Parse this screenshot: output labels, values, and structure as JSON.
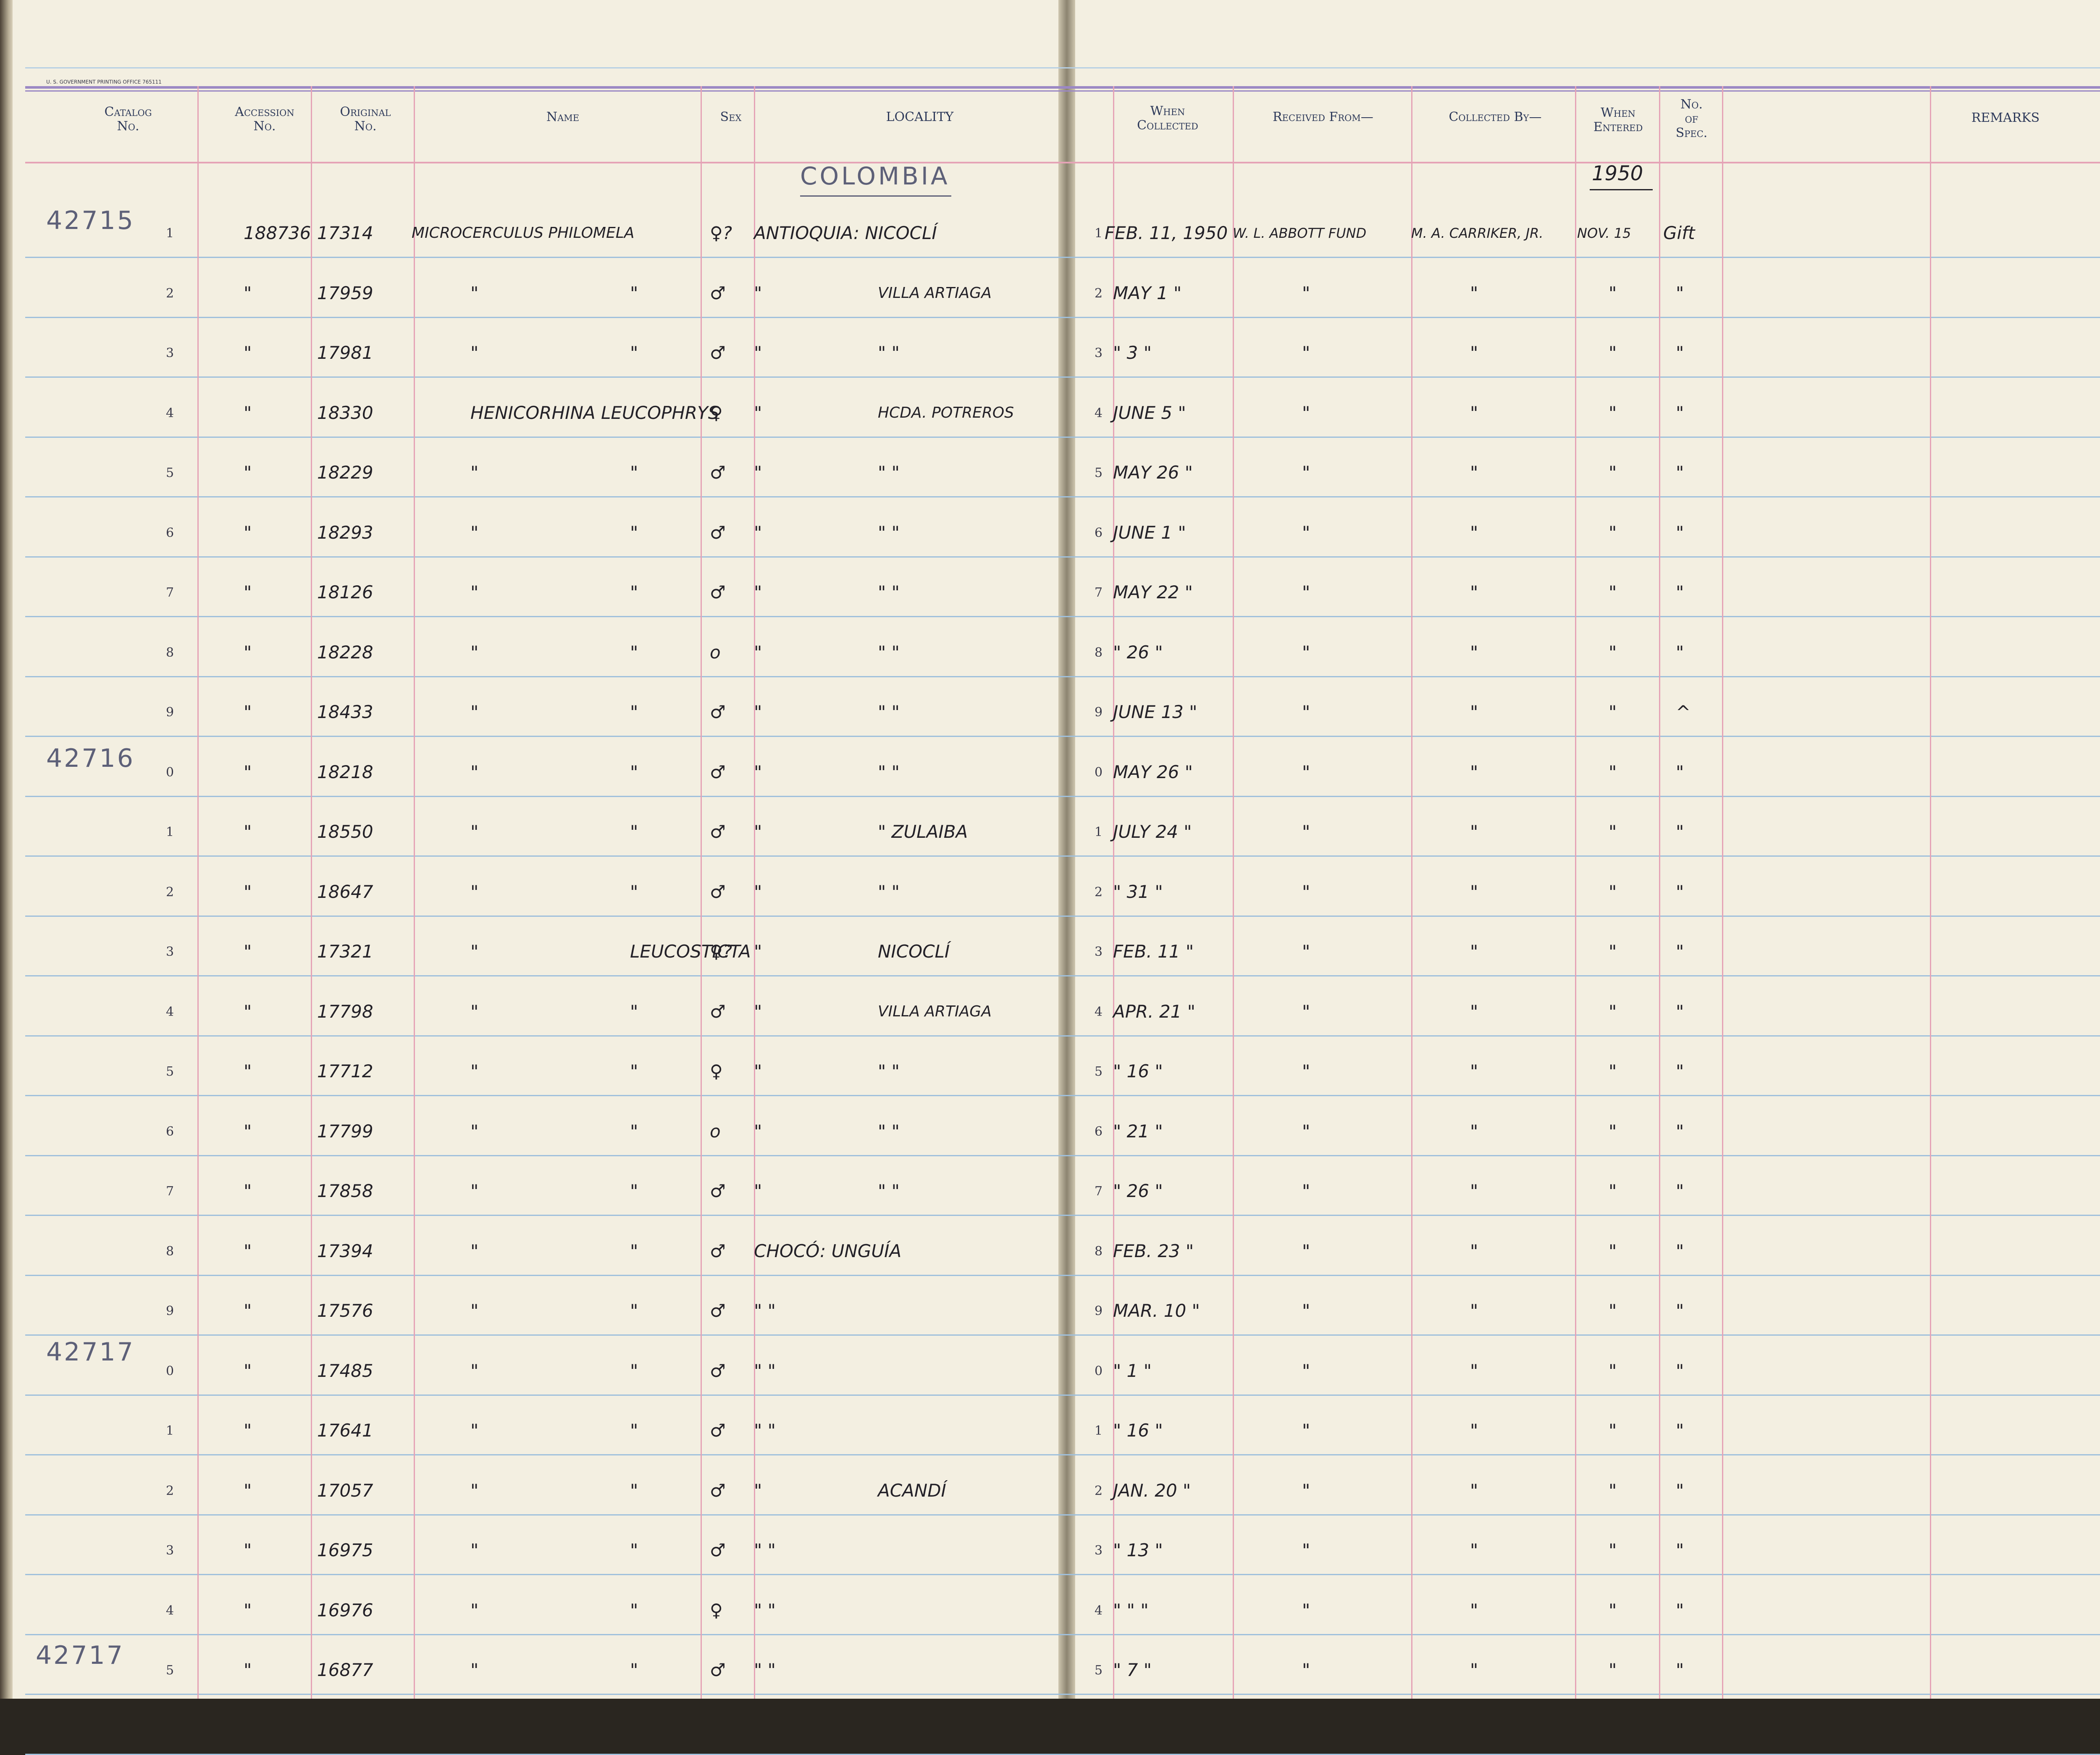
{
  "printer_line": "U. S. GOVERNMENT PRINTING OFFICE   765111",
  "headers": {
    "catalog": "Catalog\nNo.",
    "accession": "Accession\nNo.",
    "original": "Original\nNo.",
    "name": "Name",
    "sex": "Sex",
    "locality": "LOCALITY",
    "when_collected": "When\nCollected",
    "received_from": "Received From—",
    "collected_by": "Collected By—",
    "when_entered": "When\nEntered",
    "no_of_spec": "No.\nof\nSpec.",
    "remarks": "REMARKS"
  },
  "pencil": {
    "country_heading": "COLOMBIA",
    "year_entered": "1950"
  },
  "catalog_prefixes": [
    "42715",
    "42716",
    "42717",
    "42717"
  ],
  "rows": [
    {
      "digit": "1",
      "accession": "188736",
      "original": "17314",
      "name1": "MICROCERCULUS PHILOMELA",
      "name2": "",
      "sex": "♀?",
      "loc1": "ANTIOQUIA: NICOCLÍ",
      "loc2": "",
      "digit_r": "1",
      "collected": "FEB. 11, 1950",
      "received": "W. L. ABBOTT FUND",
      "collector": "M. A. CARRIKER, JR.",
      "entered": "NOV. 15",
      "spec": "Gift"
    },
    {
      "digit": "2",
      "accession": "\"",
      "original": "17959",
      "name1": "\"",
      "name2": "\"",
      "sex": "♂",
      "loc1": "\"",
      "loc2": "VILLA ARTIAGA",
      "digit_r": "2",
      "collected": "MAY 1 \"",
      "received": "\"",
      "collector": "\"",
      "entered": "\"",
      "spec": "\""
    },
    {
      "digit": "3",
      "accession": "\"",
      "original": "17981",
      "name1": "\"",
      "name2": "\"",
      "sex": "♂",
      "loc1": "\"",
      "loc2": "\"   \"",
      "digit_r": "3",
      "collected": "\" 3 \"",
      "received": "\"",
      "collector": "\"",
      "entered": "\"",
      "spec": "\""
    },
    {
      "digit": "4",
      "accession": "\"",
      "original": "18330",
      "name1": "HENICORHINA LEUCOPHRYS",
      "name2": "",
      "sex": "♀",
      "loc1": "\"",
      "loc2": "HCDA. POTREROS",
      "digit_r": "4",
      "collected": "JUNE 5 \"",
      "received": "\"",
      "collector": "\"",
      "entered": "\"",
      "spec": "\""
    },
    {
      "digit": "5",
      "accession": "\"",
      "original": "18229",
      "name1": "\"",
      "name2": "\"",
      "sex": "♂",
      "loc1": "\"",
      "loc2": "\"   \"",
      "digit_r": "5",
      "collected": "MAY 26 \"",
      "received": "\"",
      "collector": "\"",
      "entered": "\"",
      "spec": "\""
    },
    {
      "digit": "6",
      "accession": "\"",
      "original": "18293",
      "name1": "\"",
      "name2": "\"",
      "sex": "♂",
      "loc1": "\"",
      "loc2": "\"   \"",
      "digit_r": "6",
      "collected": "JUNE 1 \"",
      "received": "\"",
      "collector": "\"",
      "entered": "\"",
      "spec": "\""
    },
    {
      "digit": "7",
      "accession": "\"",
      "original": "18126",
      "name1": "\"",
      "name2": "\"",
      "sex": "♂",
      "loc1": "\"",
      "loc2": "\"   \"",
      "digit_r": "7",
      "collected": "MAY 22 \"",
      "received": "\"",
      "collector": "\"",
      "entered": "\"",
      "spec": "\""
    },
    {
      "digit": "8",
      "accession": "\"",
      "original": "18228",
      "name1": "\"",
      "name2": "\"",
      "sex": "o",
      "loc1": "\"",
      "loc2": "\"   \"",
      "digit_r": "8",
      "collected": "\" 26 \"",
      "received": "\"",
      "collector": "\"",
      "entered": "\"",
      "spec": "\""
    },
    {
      "digit": "9",
      "accession": "\"",
      "original": "18433",
      "name1": "\"",
      "name2": "\"",
      "sex": "♂",
      "loc1": "\"",
      "loc2": "\"   \"",
      "digit_r": "9",
      "collected": "JUNE 13 \"",
      "received": "\"",
      "collector": "\"",
      "entered": "\"",
      "spec": "^"
    },
    {
      "digit": "0",
      "accession": "\"",
      "original": "18218",
      "name1": "\"",
      "name2": "\"",
      "sex": "♂",
      "loc1": "\"",
      "loc2": "\"   \"",
      "digit_r": "0",
      "collected": "MAY 26 \"",
      "received": "\"",
      "collector": "\"",
      "entered": "\"",
      "spec": "\""
    },
    {
      "digit": "1",
      "accession": "\"",
      "original": "18550",
      "name1": "\"",
      "name2": "\"",
      "sex": "♂",
      "loc1": "\"",
      "loc2": "\" ZULAIBA",
      "digit_r": "1",
      "collected": "JULY 24 \"",
      "received": "\"",
      "collector": "\"",
      "entered": "\"",
      "spec": "\""
    },
    {
      "digit": "2",
      "accession": "\"",
      "original": "18647",
      "name1": "\"",
      "name2": "\"",
      "sex": "♂",
      "loc1": "\"",
      "loc2": "\"   \"",
      "digit_r": "2",
      "collected": "\" 31 \"",
      "received": "\"",
      "collector": "\"",
      "entered": "\"",
      "spec": "\""
    },
    {
      "digit": "3",
      "accession": "\"",
      "original": "17321",
      "name1": "\"",
      "name2": "LEUCOSTICTA",
      "sex": "♀?",
      "loc1": "\"",
      "loc2": "NICOCLÍ",
      "digit_r": "3",
      "collected": "FEB. 11 \"",
      "received": "\"",
      "collector": "\"",
      "entered": "\"",
      "spec": "\""
    },
    {
      "digit": "4",
      "accession": "\"",
      "original": "17798",
      "name1": "\"",
      "name2": "\"",
      "sex": "♂",
      "loc1": "\"",
      "loc2": "VILLA ARTIAGA",
      "digit_r": "4",
      "collected": "APR. 21 \"",
      "received": "\"",
      "collector": "\"",
      "entered": "\"",
      "spec": "\""
    },
    {
      "digit": "5",
      "accession": "\"",
      "original": "17712",
      "name1": "\"",
      "name2": "\"",
      "sex": "♀",
      "loc1": "\"",
      "loc2": "\"   \"",
      "digit_r": "5",
      "collected": "\" 16 \"",
      "received": "\"",
      "collector": "\"",
      "entered": "\"",
      "spec": "\""
    },
    {
      "digit": "6",
      "accession": "\"",
      "original": "17799",
      "name1": "\"",
      "name2": "\"",
      "sex": "o",
      "loc1": "\"",
      "loc2": "\"   \"",
      "digit_r": "6",
      "collected": "\" 21 \"",
      "received": "\"",
      "collector": "\"",
      "entered": "\"",
      "spec": "\""
    },
    {
      "digit": "7",
      "accession": "\"",
      "original": "17858",
      "name1": "\"",
      "name2": "\"",
      "sex": "♂",
      "loc1": "\"",
      "loc2": "\"   \"",
      "digit_r": "7",
      "collected": "\" 26 \"",
      "received": "\"",
      "collector": "\"",
      "entered": "\"",
      "spec": "\""
    },
    {
      "digit": "8",
      "accession": "\"",
      "original": "17394",
      "name1": "\"",
      "name2": "\"",
      "sex": "♂",
      "loc1": "CHOCÓ: UNGUÍA",
      "loc2": "",
      "digit_r": "8",
      "collected": "FEB. 23 \"",
      "received": "\"",
      "collector": "\"",
      "entered": "\"",
      "spec": "\""
    },
    {
      "digit": "9",
      "accession": "\"",
      "original": "17576",
      "name1": "\"",
      "name2": "\"",
      "sex": "♂",
      "loc1": "\"   \"",
      "loc2": "",
      "digit_r": "9",
      "collected": "MAR. 10 \"",
      "received": "\"",
      "collector": "\"",
      "entered": "\"",
      "spec": "\""
    },
    {
      "digit": "0",
      "accession": "\"",
      "original": "17485",
      "name1": "\"",
      "name2": "\"",
      "sex": "♂",
      "loc1": "\"   \"",
      "loc2": "",
      "digit_r": "0",
      "collected": "\" 1 \"",
      "received": "\"",
      "collector": "\"",
      "entered": "\"",
      "spec": "\""
    },
    {
      "digit": "1",
      "accession": "\"",
      "original": "17641",
      "name1": "\"",
      "name2": "\"",
      "sex": "♂",
      "loc1": "\"   \"",
      "loc2": "",
      "digit_r": "1",
      "collected": "\" 16 \"",
      "received": "\"",
      "collector": "\"",
      "entered": "\"",
      "spec": "\""
    },
    {
      "digit": "2",
      "accession": "\"",
      "original": "17057",
      "name1": "\"",
      "name2": "\"",
      "sex": "♂",
      "loc1": "\"",
      "loc2": "ACANDÍ",
      "digit_r": "2",
      "collected": "JAN. 20 \"",
      "received": "\"",
      "collector": "\"",
      "entered": "\"",
      "spec": "\""
    },
    {
      "digit": "3",
      "accession": "\"",
      "original": "16975",
      "name1": "\"",
      "name2": "\"",
      "sex": "♂",
      "loc1": "\"   \"",
      "loc2": "",
      "digit_r": "3",
      "collected": "\" 13 \"",
      "received": "\"",
      "collector": "\"",
      "entered": "\"",
      "spec": "\""
    },
    {
      "digit": "4",
      "accession": "\"",
      "original": "16976",
      "name1": "\"",
      "name2": "\"",
      "sex": "♀",
      "loc1": "\"   \"",
      "loc2": "",
      "digit_r": "4",
      "collected": "\" \" \"",
      "received": "\"",
      "collector": "\"",
      "entered": "\"",
      "spec": "\""
    },
    {
      "digit": "5",
      "accession": "\"",
      "original": "16877",
      "name1": "\"",
      "name2": "\"",
      "sex": "♂",
      "loc1": "\"   \"",
      "loc2": "",
      "digit_r": "5",
      "collected": "\" 7 \"",
      "received": "\"",
      "collector": "\"",
      "entered": "\"",
      "spec": "\""
    }
  ],
  "colors": {
    "paper": "#f3efe1",
    "rule_blue": "#9fc0dc",
    "rule_red": "#e5a3b6",
    "rule_violet": "#9b88c4",
    "ink": "#232128",
    "pencil": "#5d6078"
  }
}
